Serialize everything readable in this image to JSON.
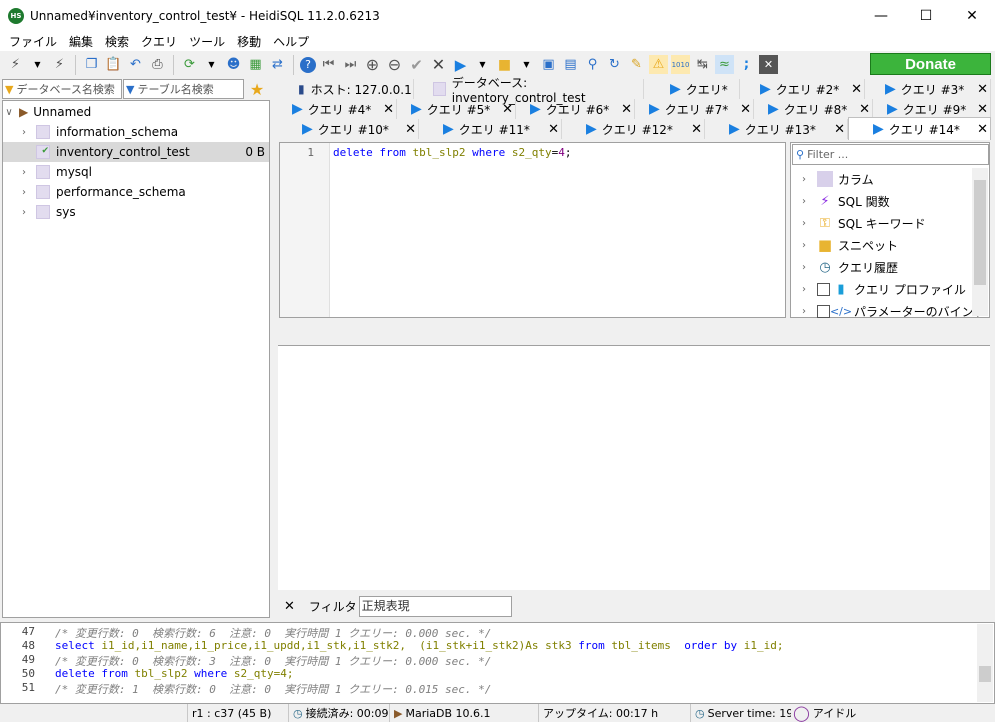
{
  "window": {
    "title": "Unnamed¥inventory_control_test¥ - HeidiSQL 11.2.0.6213",
    "app_icon_text": "HS"
  },
  "menu": [
    "ファイル",
    "編集",
    "検索",
    "クエリ",
    "ツール",
    "移動",
    "ヘルプ"
  ],
  "donate_label": "Donate",
  "left_panel": {
    "db_search_placeholder": "データベース名検索",
    "table_search_placeholder": "テーブル名検索",
    "root": "Unnamed",
    "databases": [
      {
        "name": "information_schema",
        "size": ""
      },
      {
        "name": "inventory_control_test",
        "size": "0 B"
      },
      {
        "name": "mysql",
        "size": ""
      },
      {
        "name": "performance_schema",
        "size": ""
      },
      {
        "name": "sys",
        "size": ""
      }
    ]
  },
  "tabs": {
    "row1": [
      "ホスト: 127.0.0.1",
      "データベース: inventory_control_test",
      "クエリ*",
      "クエリ #2*",
      "クエリ #3*"
    ],
    "row2": [
      "クエリ #4*",
      "クエリ #5*",
      "クエリ #6*",
      "クエリ #7*",
      "クエリ #8*",
      "クエリ #9*"
    ],
    "row3": [
      "クエリ #10*",
      "クエリ #11*",
      "クエリ #12*",
      "クエリ #13*",
      "クエリ #14*"
    ],
    "active": "クエリ #14*"
  },
  "editor": {
    "line_number": "1",
    "kw1": "delete",
    "kw2": "from",
    "table": "tbl_slp2",
    "kw3": "where",
    "column": "s2_qty",
    "op": "=",
    "value": "4",
    "end": ";"
  },
  "helpers": {
    "filter_placeholder": "Filter ...",
    "items": [
      "カラム",
      "SQL 関数",
      "SQL キーワード",
      "スニペット",
      "クエリ履歴",
      "クエリ プロファイル",
      "パラメーターのバインド"
    ]
  },
  "filterbar": {
    "label": "フィルタ",
    "placeholder": "正規表現"
  },
  "log": {
    "lines": [
      {
        "n": "47",
        "text": "/* 変更行数: 0  検索行数: 6  注意: 0  実行時間 1 クエリー: 0.000 sec. */",
        "type": "comment"
      },
      {
        "n": "48",
        "type": "select",
        "parts": [
          "select",
          " i1_id,i1_name,i1_price,i1_updd,i1_stk,i1_stk2,  (i1_stk+i1_stk2)As stk3 ",
          "from",
          " tbl_items  ",
          "order by",
          " i1_id;"
        ]
      },
      {
        "n": "49",
        "text": "/* 変更行数: 0  検索行数: 3  注意: 0  実行時間 1 クエリー: 0.000 sec. */",
        "type": "comment"
      },
      {
        "n": "50",
        "type": "delete",
        "parts": [
          "delete",
          " ",
          "from",
          " tbl_slp2 ",
          "where",
          " s2_qty=4;"
        ]
      },
      {
        "n": "51",
        "text": "/* 変更行数: 1  検索行数: 0  注意: 0  実行時間 1 クエリー: 0.015 sec. */",
        "type": "comment"
      }
    ]
  },
  "status": {
    "cursor": "r1 : c37 (45 B)",
    "connected": "接続済み: 00:09",
    "server": "MariaDB 10.6.1",
    "uptime": "アップタイム: 00:17 h",
    "server_time": "Server time: 19:",
    "idle": "アイドル"
  }
}
